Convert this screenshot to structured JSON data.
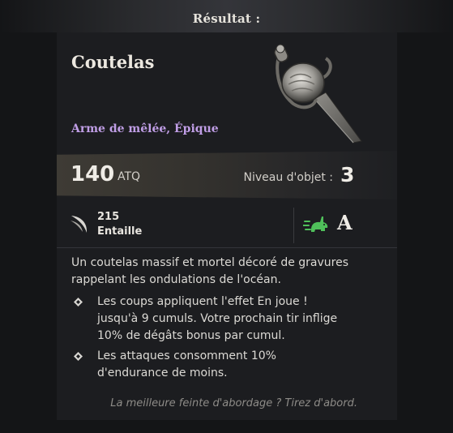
{
  "header": {
    "title": "Résultat :"
  },
  "item": {
    "name": "Coutelas",
    "type": "Arme de mêlée, Épique",
    "attack": {
      "value": "140",
      "unit": "ATQ"
    },
    "level": {
      "label": "Niveau d'objet :",
      "value": "3"
    },
    "damage": {
      "value": "215",
      "type": "Entaille",
      "icon": "slash-icon"
    },
    "scaling": {
      "icon": "rabbit-icon",
      "grade": "A",
      "icon_color": "#4fbf5a"
    },
    "description": "Un coutelas massif et mortel décoré de gravures rappelant les ondulations de l'océan.",
    "effects": [
      {
        "text": "Les coups appliquent l'effet En joue ! jusqu'à 9 cumuls. Votre prochain tir inflige 10% de dégâts bonus par cumul."
      },
      {
        "text": "Les attaques consomment 10% d'endurance de moins."
      }
    ],
    "flavor": "La meilleure feinte d'abordage ? Tirez d'abord."
  },
  "colors": {
    "rarity_epic": "#c09ee6",
    "background": "#141517",
    "card": "#1c1d20"
  }
}
